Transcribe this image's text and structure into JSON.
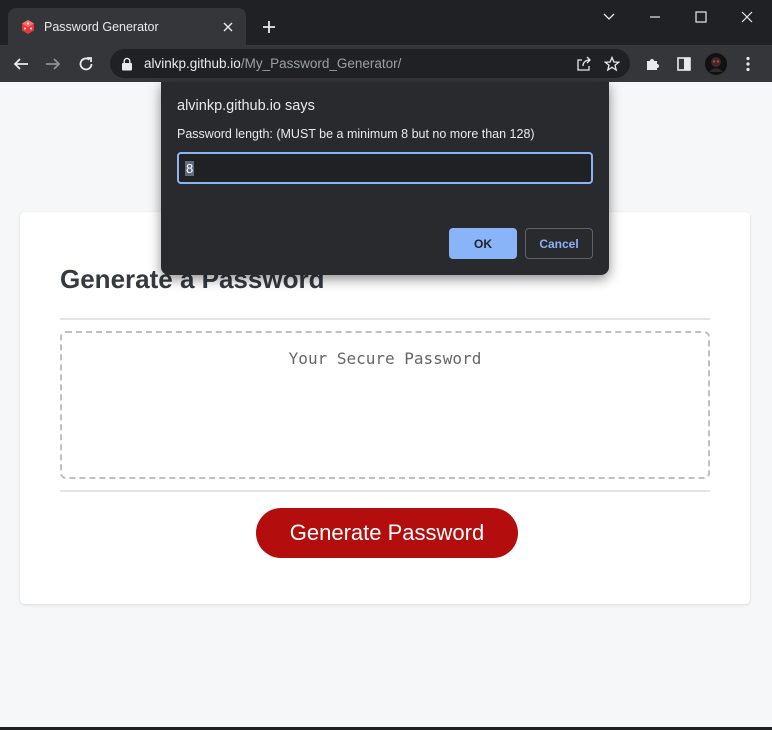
{
  "browser": {
    "tab": {
      "title": "Password Generator"
    },
    "url": {
      "host": "alvinkp.github.io",
      "path": "/My_Password_Generator/"
    },
    "icons": [
      "tab-favicon-icon",
      "close-icon",
      "plus-icon",
      "chevron-down-icon",
      "minimize-icon",
      "maximize-icon",
      "close-window-icon",
      "back-arrow-icon",
      "forward-arrow-icon",
      "reload-icon",
      "lock-icon",
      "share-icon",
      "star-icon",
      "extensions-icon",
      "side-panel-icon",
      "avatar",
      "kebab-menu-icon"
    ]
  },
  "page": {
    "card_title": "Generate a Password",
    "password_placeholder": "Your Secure Password",
    "generate_button": "Generate Password",
    "colors": {
      "accent": "#b30d0d",
      "background": "#f6f7f9",
      "title": "#343a40"
    }
  },
  "dialog": {
    "title": "alvinkp.github.io says",
    "message": "Password length: (MUST be a minimum 8 but no more than 128)",
    "input_value": "8",
    "ok_label": "OK",
    "cancel_label": "Cancel",
    "colors": {
      "background": "#292a2d",
      "accent": "#8ab4f8"
    }
  }
}
